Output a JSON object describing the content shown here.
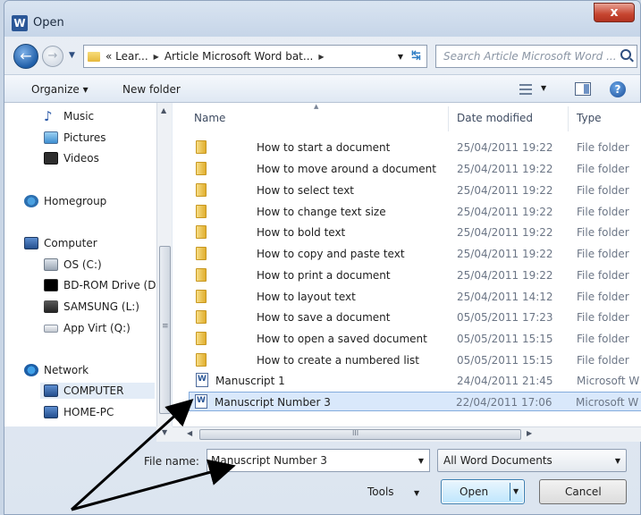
{
  "window": {
    "title": "Open",
    "app_icon_letter": "W",
    "close_glyph": "x"
  },
  "nav": {
    "breadcrumbs": [
      "« Lear...",
      "Article Microsoft Word bat..."
    ],
    "search_placeholder": "Search Article Microsoft Word ..."
  },
  "toolbar": {
    "organize": "Organize ▾",
    "new_folder": "New folder"
  },
  "navpane": {
    "items": [
      {
        "label": "Music",
        "icon": "music-icon"
      },
      {
        "label": "Pictures",
        "icon": "pictures-icon"
      },
      {
        "label": "Videos",
        "icon": "videos-icon"
      },
      {
        "label": "Homegroup",
        "icon": "homegroup-icon"
      },
      {
        "label": "Computer",
        "icon": "computer-icon"
      },
      {
        "label": "OS (C:)",
        "icon": "drive-icon"
      },
      {
        "label": "BD-ROM Drive (D",
        "icon": "bd-rom-icon"
      },
      {
        "label": "SAMSUNG (L:)",
        "icon": "samsung-drive-icon"
      },
      {
        "label": "App Virt (Q:)",
        "icon": "network-drive-icon"
      },
      {
        "label": "Network",
        "icon": "network-icon"
      },
      {
        "label": "COMPUTER",
        "icon": "computer-icon"
      },
      {
        "label": "HOME-PC",
        "icon": "computer-icon"
      }
    ]
  },
  "columns": {
    "name": "Name",
    "date": "Date modified",
    "type": "Type"
  },
  "files": [
    {
      "name": "How to start a document",
      "date": "25/04/2011 19:22",
      "type": "File folder"
    },
    {
      "name": "How to move around a document",
      "date": "25/04/2011 19:22",
      "type": "File folder"
    },
    {
      "name": "How to select text",
      "date": "25/04/2011 19:22",
      "type": "File folder"
    },
    {
      "name": "How to change text size",
      "date": "25/04/2011 19:22",
      "type": "File folder"
    },
    {
      "name": "How to bold text",
      "date": "25/04/2011 19:22",
      "type": "File folder"
    },
    {
      "name": "How to copy and paste text",
      "date": "25/04/2011 19:22",
      "type": "File folder"
    },
    {
      "name": "How to print a document",
      "date": "25/04/2011 19:22",
      "type": "File folder"
    },
    {
      "name": "How to layout text",
      "date": "25/04/2011 14:12",
      "type": "File folder"
    },
    {
      "name": "How to save a document",
      "date": "05/05/2011 17:23",
      "type": "File folder"
    },
    {
      "name": "How to open a saved document",
      "date": "05/05/2011 15:15",
      "type": "File folder"
    },
    {
      "name": "How to create a numbered list",
      "date": "05/05/2011 15:15",
      "type": "File folder"
    },
    {
      "name": "Manuscript 1",
      "date": "24/04/2011 21:45",
      "type": "Microsoft W"
    },
    {
      "name": "Manuscript Number 3",
      "date": "22/04/2011 17:06",
      "type": "Microsoft W"
    }
  ],
  "bottom": {
    "file_name_label": "File name:",
    "file_name_value": "Manuscript Number 3",
    "file_type": "All Word Documents",
    "tools": "Tools",
    "open": "Open",
    "cancel": "Cancel"
  },
  "colors": {
    "accent": "#2b5797",
    "selection": "#d9e8fb",
    "annotation_arrow": "#000000"
  }
}
